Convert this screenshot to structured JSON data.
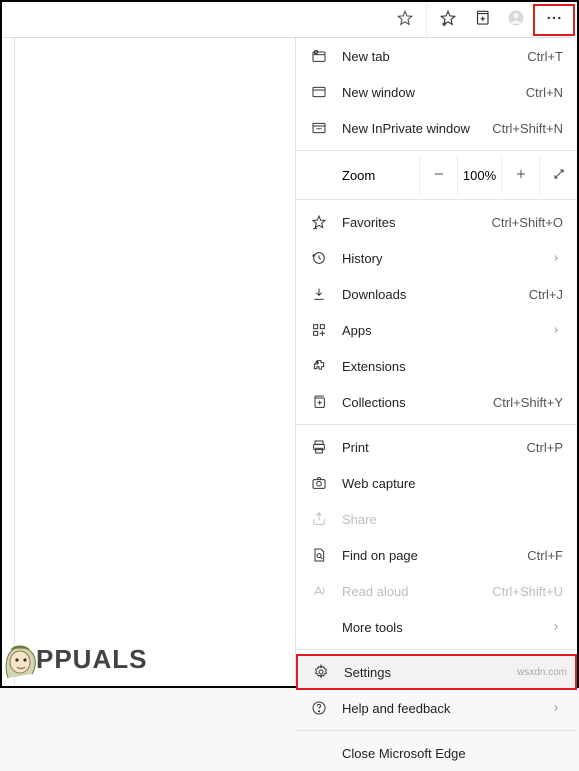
{
  "toolbar": {
    "icons": {
      "favorite": "favorite-star-icon",
      "favorites_list": "favorites-plus-icon",
      "collections": "collections-icon",
      "profile": "profile-icon",
      "more": "more-icon"
    }
  },
  "menu": {
    "new_tab": {
      "label": "New tab",
      "shortcut": "Ctrl+T"
    },
    "new_window": {
      "label": "New window",
      "shortcut": "Ctrl+N"
    },
    "new_inprivate": {
      "label": "New InPrivate window",
      "shortcut": "Ctrl+Shift+N"
    },
    "zoom": {
      "label": "Zoom",
      "value": "100%"
    },
    "favorites": {
      "label": "Favorites",
      "shortcut": "Ctrl+Shift+O"
    },
    "history": {
      "label": "History"
    },
    "downloads": {
      "label": "Downloads",
      "shortcut": "Ctrl+J"
    },
    "apps": {
      "label": "Apps"
    },
    "extensions": {
      "label": "Extensions"
    },
    "collections": {
      "label": "Collections",
      "shortcut": "Ctrl+Shift+Y"
    },
    "print": {
      "label": "Print",
      "shortcut": "Ctrl+P"
    },
    "web_capture": {
      "label": "Web capture"
    },
    "share": {
      "label": "Share"
    },
    "find_on_page": {
      "label": "Find on page",
      "shortcut": "Ctrl+F"
    },
    "read_aloud": {
      "label": "Read aloud",
      "shortcut": "Ctrl+Shift+U"
    },
    "more_tools": {
      "label": "More tools"
    },
    "settings": {
      "label": "Settings"
    },
    "help": {
      "label": "Help and feedback"
    },
    "close": {
      "label": "Close Microsoft Edge"
    }
  },
  "watermark": "wsxdn.com",
  "brand": "PPUALS"
}
